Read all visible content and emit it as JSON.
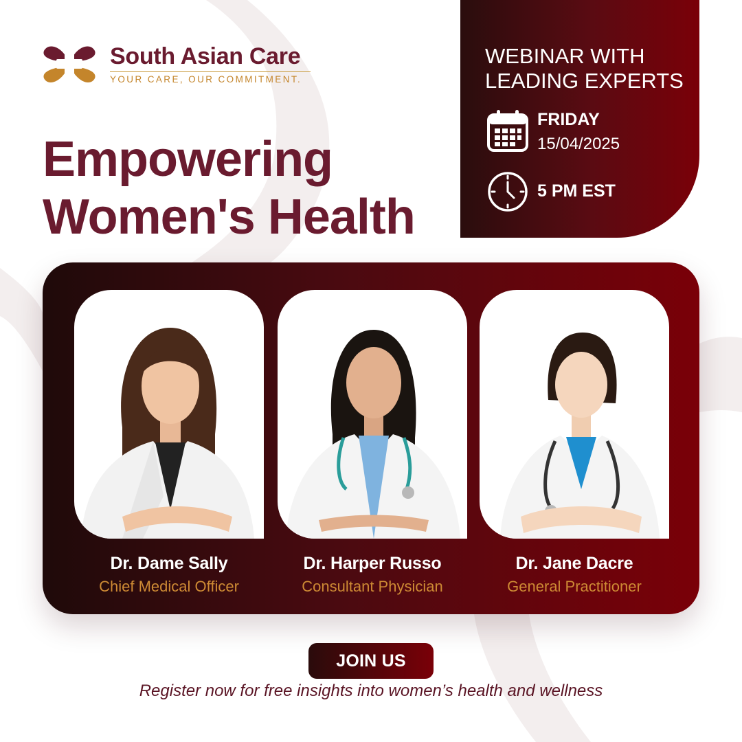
{
  "brand": {
    "name": "South Asian Care",
    "tagline": "YOUR CARE, OUR COMMITMENT."
  },
  "headline": {
    "line1": "Empowering",
    "line2": "Women's Health"
  },
  "webinar": {
    "title_line1": "WEBINAR WITH",
    "title_line2": "LEADING EXPERTS",
    "day": "FRIDAY",
    "date": "15/04/2025",
    "time": "5 PM EST",
    "calendar_icon": "calendar-icon",
    "clock_icon": "clock-icon"
  },
  "speakers": [
    {
      "name": "Dr. Dame Sally",
      "role": "Chief Medical Officer"
    },
    {
      "name": "Dr. Harper Russo",
      "role": "Consultant Physician"
    },
    {
      "name": "Dr. Jane Dacre",
      "role": "General Practitioner"
    }
  ],
  "cta": {
    "button_label": "JOIN US",
    "register_text": "Register now for free insights into women’s health and wellness"
  },
  "colors": {
    "brand_maroon": "#6a1b2f",
    "accent_gold": "#c4852b",
    "panel_dark": "#2a0d0d",
    "panel_red": "#7a0008"
  }
}
